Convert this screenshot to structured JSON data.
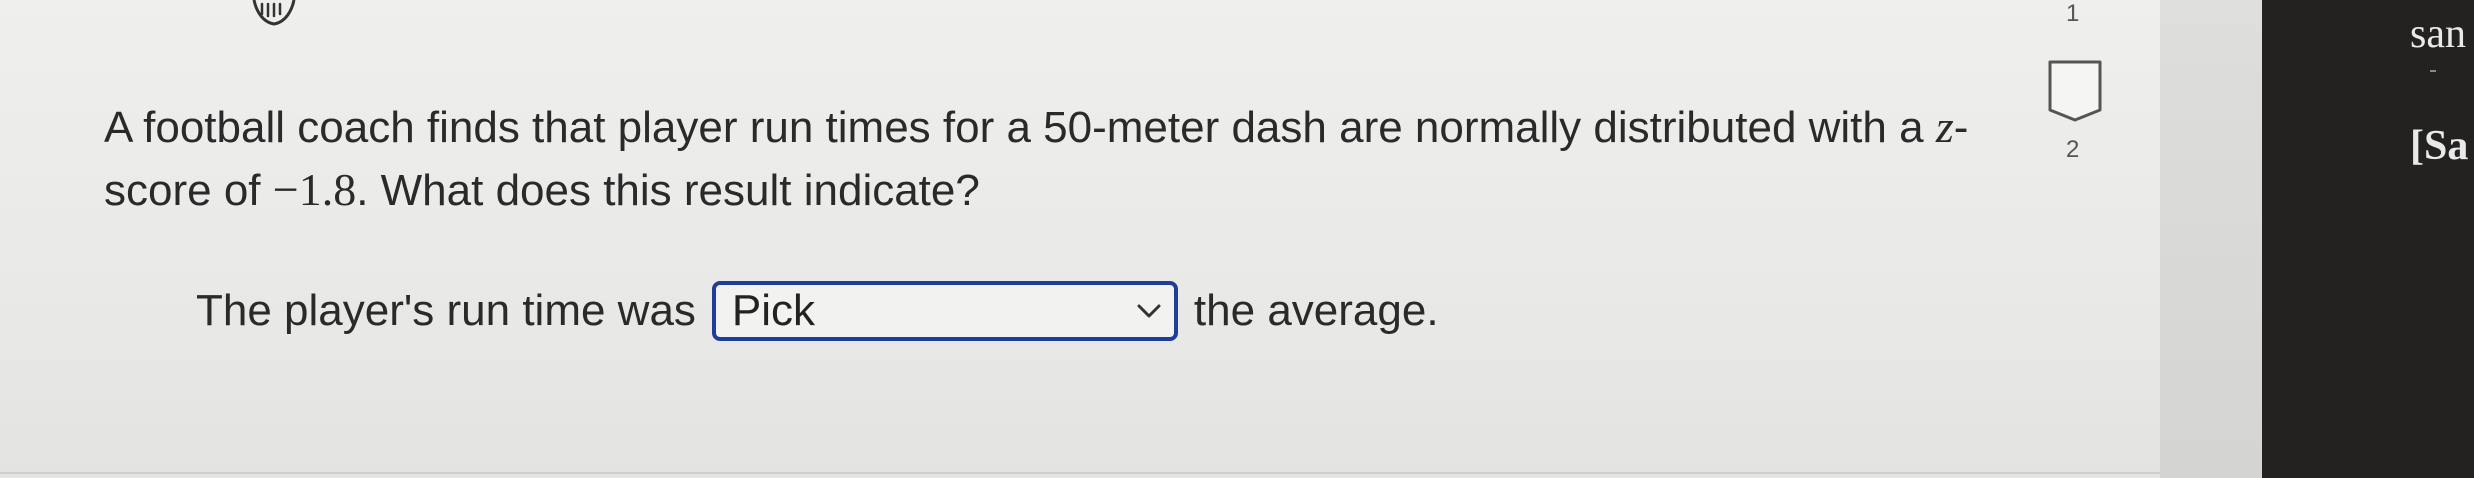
{
  "question": {
    "text_before_z": "A football coach finds that player run times for a 50-meter dash are normally distributed with a ",
    "z_variable": "z",
    "text_after_z": "-score of ",
    "z_value": "−1.8",
    "text_end": ". What does this result indicate?"
  },
  "answer": {
    "prefix": "The player's run time was",
    "select_value": "Pick",
    "suffix": "the average."
  },
  "side_indicator": {
    "top_number": "1",
    "bottom_number": "2"
  },
  "right_panel": {
    "line1": "san",
    "line2": "[Sa"
  },
  "colors": {
    "select_border": "#1e3e9a",
    "right_panel_bg": "#232221"
  },
  "icons": {
    "hand": "hand-pointer-icon",
    "chevron": "chevron-down-icon"
  }
}
